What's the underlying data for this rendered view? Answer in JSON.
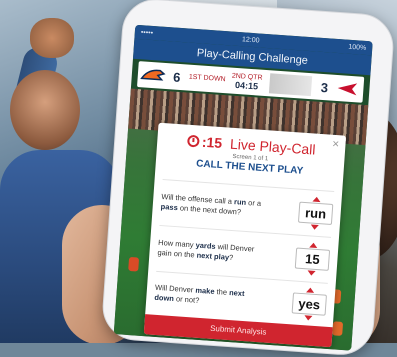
{
  "status_bar": {
    "time": "12:00",
    "battery": "100%"
  },
  "app": {
    "title": "Play-Calling Challenge"
  },
  "scoreboard": {
    "home_score": "6",
    "quarter_label": "1ST DOWN",
    "quarter": "2ND QTR",
    "clock": "04:15",
    "away_score": "3"
  },
  "modal": {
    "timer": ":15",
    "title": "Live Play-Call",
    "screen_count": "Screen 1 of 1",
    "heading": "CALL THE NEXT PLAY",
    "questions": [
      {
        "text_pre": "Will the offense call a ",
        "text_b1": "run",
        "text_mid": " or a ",
        "text_b2": "pass",
        "text_post": " on the next down?",
        "answer": "run"
      },
      {
        "text_pre": "How many ",
        "text_b1": "yards",
        "text_mid": " will Denver gain on the ",
        "text_b2": "next play",
        "text_post": "?",
        "answer": "15"
      },
      {
        "text_pre": "Will Denver ",
        "text_b1": "make",
        "text_mid": " the ",
        "text_b2": "next down",
        "text_post": " or not?",
        "answer": "yes"
      }
    ],
    "submit_label": "Submit Analysis"
  },
  "colors": {
    "accent": "#d0252f",
    "brand": "#1d4f8e"
  }
}
